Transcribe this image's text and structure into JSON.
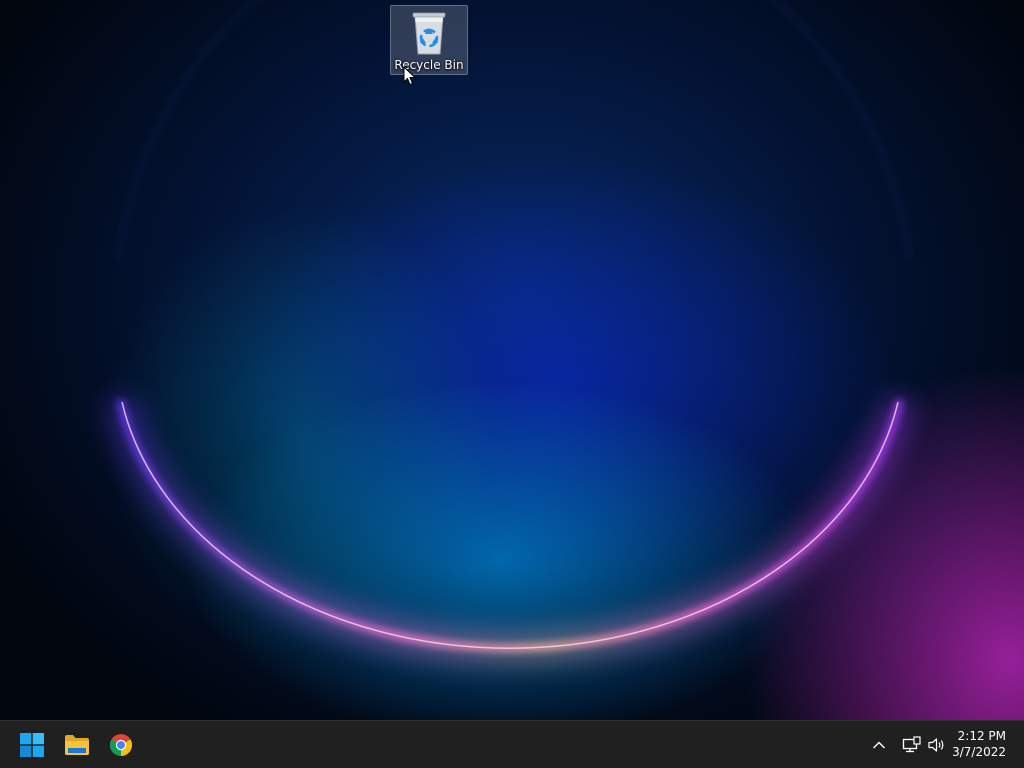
{
  "desktop": {
    "icons": [
      {
        "label": "Recycle Bin",
        "icon": "recycle-bin-icon"
      }
    ]
  },
  "taskbar": {
    "pinned": [
      {
        "name": "Start",
        "icon": "windows-start-icon"
      },
      {
        "name": "File Explorer",
        "icon": "folder-icon"
      },
      {
        "name": "Google Chrome",
        "icon": "chrome-icon"
      }
    ],
    "tray": {
      "overflow_icon": "chevron-up-icon",
      "network_icon": "network-icon",
      "volume_icon": "volume-icon",
      "time": "2:12 PM",
      "date": "3/7/2022"
    },
    "background": "#202020"
  },
  "theme": {
    "accent": "#1ea6f0",
    "folder_yellow": "#f5c33b"
  }
}
